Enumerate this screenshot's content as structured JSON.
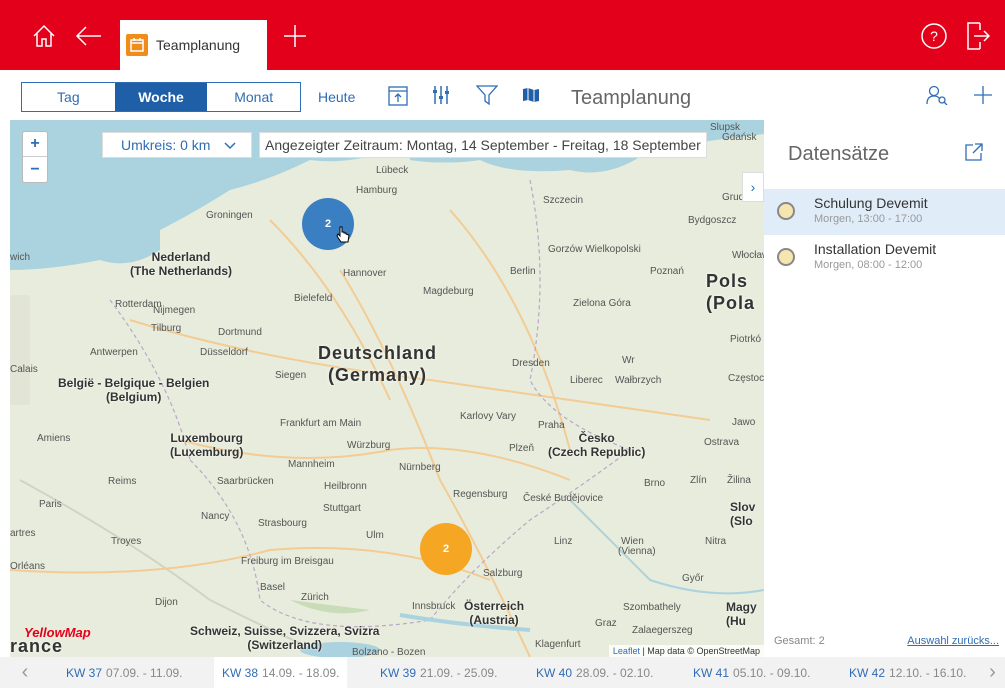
{
  "header": {
    "tab_label": "Teamplanung",
    "icons": [
      "home-icon",
      "back-icon",
      "add-tab-icon",
      "help-icon",
      "logout-icon"
    ],
    "accent": "#e3001b"
  },
  "toolbar": {
    "views": [
      "Tag",
      "Woche",
      "Monat"
    ],
    "active_view": "Woche",
    "today_label": "Heute",
    "title": "Teamplanung"
  },
  "map": {
    "radius_label": "Umkreis: 0 km",
    "range_label": "Angezeigter Zeitraum: Montag, 14 September - Freitag, 18 September",
    "clusters": [
      {
        "count": "2",
        "color": "#3a7fc1"
      },
      {
        "count": "2",
        "color": "#f5a623"
      }
    ],
    "logo": "YellowMap",
    "attribution_leaflet": "Leaflet",
    "attribution_text": " | Map data © OpenStreetMap",
    "countries": {
      "nl": "Nederland\n(The Netherlands)",
      "de": "Deutschland\n(Germany)",
      "be": "België - Belgique - Belgien\n(Belgium)",
      "lu": "Luxembourg\n(Luxemburg)",
      "cz": "Česko\n(Czech Republic)",
      "at": "Österreich\n(Austria)",
      "ch": "Schweiz, Suisse, Svizzera, Svizra\n(Switzerland)",
      "pl": "Pols\n(Pola",
      "fr": "rance"
    }
  },
  "panel": {
    "title": "Datensätze",
    "records": [
      {
        "title": "Schulung Devemit",
        "sub": "Morgen, 13:00 - 17:00"
      },
      {
        "title": "Installation Devemit",
        "sub": "Morgen, 08:00 - 12:00"
      }
    ],
    "total": "Gesamt: 2",
    "reset": "Auswahl zurücks..."
  },
  "weeks": [
    {
      "kw": "KW 37",
      "dates": "07.09. - 11.09."
    },
    {
      "kw": "KW 38",
      "dates": "14.09. - 18.09."
    },
    {
      "kw": "KW 39",
      "dates": "21.09. - 25.09."
    },
    {
      "kw": "KW 40",
      "dates": "28.09. - 02.10."
    },
    {
      "kw": "KW 41",
      "dates": "05.10. - 09.10."
    },
    {
      "kw": "KW 42",
      "dates": "12.10. - 16.10."
    }
  ]
}
